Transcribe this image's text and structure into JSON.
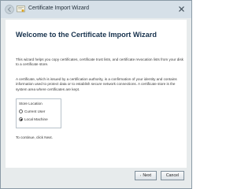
{
  "window": {
    "title": "Certificate Import Wizard"
  },
  "page": {
    "heading": "Welcome to the Certificate Import Wizard",
    "intro": "This wizard helps you copy certificates, certificate trust lists, and certificate revocation lists from your disk to a certificate store.",
    "description": "A certificate, which is issued by a certification authority, is a confirmation of your identity and contains information used to protect data or to establish secure network connections. A certificate store is the system area where certificates are kept.",
    "store_location": {
      "legend": "Store Location",
      "options": [
        {
          "label": "Current User",
          "checked": false
        },
        {
          "label": "Local Machine",
          "checked": true
        }
      ]
    },
    "continue_text": "To continue, click Next."
  },
  "footer": {
    "next_label": "Next",
    "cancel_label": "Cancel"
  },
  "icons": {
    "back": "back-arrow-icon",
    "app": "certificate-icon",
    "close": "close-icon",
    "next_shield": "uac-shield-icon"
  }
}
